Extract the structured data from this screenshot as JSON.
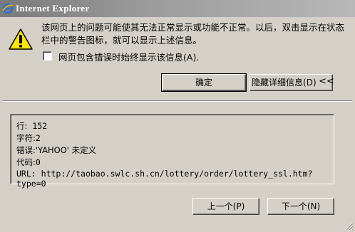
{
  "window": {
    "title": "Internet Explorer"
  },
  "message": {
    "text": "该网页上的问题可能使其无法正常显示或功能不正常。以后，双击显示在状态栏中的警告图标，就可以显示上述信息。"
  },
  "checkbox": {
    "label": "网页包含错误时始终显示该信息",
    "shortcut": "(A).",
    "checked": false
  },
  "buttons": {
    "ok": "确定",
    "details": "隐藏详细信息",
    "details_shortcut": "(D)",
    "chevron": "<<",
    "prev": "上一个",
    "prev_shortcut": "(P)",
    "next": "下一个",
    "next_shortcut": "(N)"
  },
  "details": {
    "line_label": "行:",
    "line_value": "152",
    "char_label": "字符:",
    "char_value": "2",
    "error_label": "错误:",
    "error_value": "'YAHOO' 未定义",
    "code_label": "代码:",
    "code_value": "0",
    "url_label": "URL:",
    "url_value": "http://taobao.swlc.sh.cn/lottery/order/lottery_ssl.htm?type=0"
  },
  "icons": {
    "title": "ie-logo-icon",
    "warning": "warning-icon"
  },
  "colors": {
    "dialog_bg": "#d4d0c8",
    "titlebar": "#8c8c8c",
    "warning_fill": "#ffe600"
  }
}
